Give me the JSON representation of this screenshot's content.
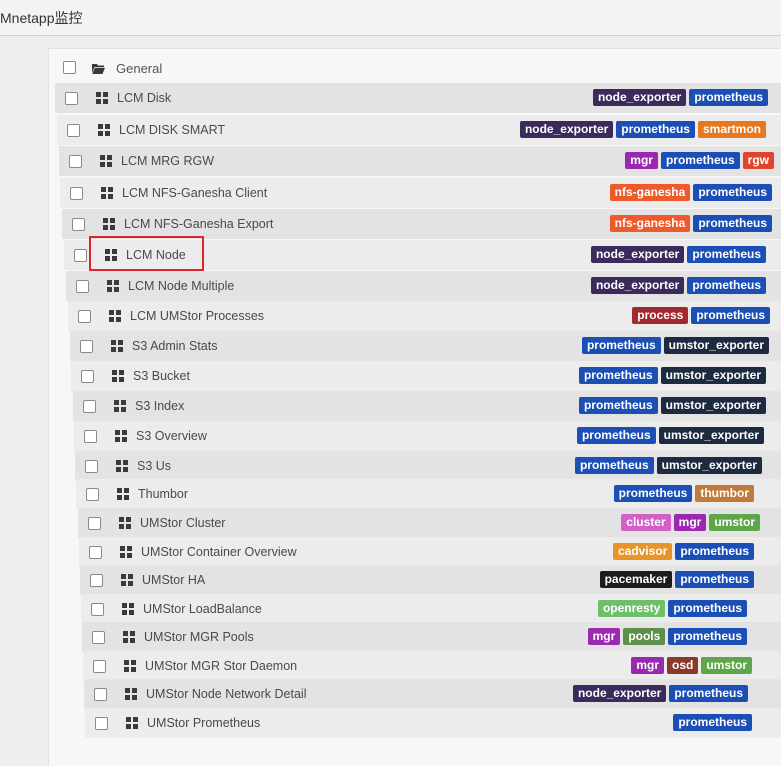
{
  "app": {
    "title": "Mnetapp监控"
  },
  "folder": {
    "label": "General"
  },
  "dashboards": [
    {
      "name": "LCM Disk",
      "tags": [
        {
          "label": "node_exporter",
          "color": "#3b2a5c"
        },
        {
          "label": "prometheus",
          "color": "#1b4fb5"
        }
      ]
    },
    {
      "name": "LCM DISK SMART",
      "tags": [
        {
          "label": "node_exporter",
          "color": "#3b2a5c"
        },
        {
          "label": "prometheus",
          "color": "#1b4fb5"
        },
        {
          "label": "smartmon",
          "color": "#e6781f"
        }
      ]
    },
    {
      "name": "LCM MRG RGW",
      "tags": [
        {
          "label": "mgr",
          "color": "#9b28b0"
        },
        {
          "label": "prometheus",
          "color": "#1b4fb5"
        },
        {
          "label": "rgw",
          "color": "#e0452c"
        }
      ]
    },
    {
      "name": "LCM NFS-Ganesha Client",
      "tags": [
        {
          "label": "nfs-ganesha",
          "color": "#ee5a2c"
        },
        {
          "label": "prometheus",
          "color": "#1b4fb5"
        }
      ]
    },
    {
      "name": "LCM NFS-Ganesha Export",
      "tags": [
        {
          "label": "nfs-ganesha",
          "color": "#ee5a2c"
        },
        {
          "label": "prometheus",
          "color": "#1b4fb5"
        }
      ]
    },
    {
      "name": "LCM Node",
      "tags": [
        {
          "label": "node_exporter",
          "color": "#3b2a5c"
        },
        {
          "label": "prometheus",
          "color": "#1b4fb5"
        }
      ]
    },
    {
      "name": "LCM Node Multiple",
      "tags": [
        {
          "label": "node_exporter",
          "color": "#3b2a5c"
        },
        {
          "label": "prometheus",
          "color": "#1b4fb5"
        }
      ]
    },
    {
      "name": "LCM UMStor Processes",
      "tags": [
        {
          "label": "process",
          "color": "#a12a2e"
        },
        {
          "label": "prometheus",
          "color": "#1b4fb5"
        }
      ]
    },
    {
      "name": "S3 Admin Stats",
      "tags": [
        {
          "label": "prometheus",
          "color": "#1b4fb5"
        },
        {
          "label": "umstor_exporter",
          "color": "#1e2a40"
        }
      ]
    },
    {
      "name": "S3 Bucket",
      "tags": [
        {
          "label": "prometheus",
          "color": "#1b4fb5"
        },
        {
          "label": "umstor_exporter",
          "color": "#1e2a40"
        }
      ]
    },
    {
      "name": "S3 Index",
      "tags": [
        {
          "label": "prometheus",
          "color": "#1b4fb5"
        },
        {
          "label": "umstor_exporter",
          "color": "#1e2a40"
        }
      ]
    },
    {
      "name": "S3 Overview",
      "tags": [
        {
          "label": "prometheus",
          "color": "#1b4fb5"
        },
        {
          "label": "umstor_exporter",
          "color": "#1e2a40"
        }
      ]
    },
    {
      "name": "S3 Us",
      "tags": [
        {
          "label": "prometheus",
          "color": "#1b4fb5"
        },
        {
          "label": "umstor_exporter",
          "color": "#1e2a40"
        }
      ]
    },
    {
      "name": "Thumbor",
      "tags": [
        {
          "label": "prometheus",
          "color": "#1b4fb5"
        },
        {
          "label": "thumbor",
          "color": "#c07a3a"
        }
      ]
    },
    {
      "name": "UMStor Cluster",
      "tags": [
        {
          "label": "cluster",
          "color": "#d45fc8"
        },
        {
          "label": "mgr",
          "color": "#9b28b0"
        },
        {
          "label": "umstor",
          "color": "#5fa64a"
        }
      ]
    },
    {
      "name": "UMStor Container Overview",
      "tags": [
        {
          "label": "cadvisor",
          "color": "#e6952a"
        },
        {
          "label": "prometheus",
          "color": "#1b4fb5"
        }
      ]
    },
    {
      "name": "UMStor HA",
      "tags": [
        {
          "label": "pacemaker",
          "color": "#1c1c1c"
        },
        {
          "label": "prometheus",
          "color": "#1b4fb5"
        }
      ]
    },
    {
      "name": "UMStor LoadBalance",
      "tags": [
        {
          "label": "openresty",
          "color": "#6fbf6a"
        },
        {
          "label": "prometheus",
          "color": "#1b4fb5"
        }
      ]
    },
    {
      "name": "UMStor MGR Pools",
      "tags": [
        {
          "label": "mgr",
          "color": "#9b28b0"
        },
        {
          "label": "pools",
          "color": "#5f8f4a"
        },
        {
          "label": "prometheus",
          "color": "#1b4fb5"
        }
      ]
    },
    {
      "name": "UMStor MGR Stor Daemon",
      "tags": [
        {
          "label": "mgr",
          "color": "#9b28b0"
        },
        {
          "label": "osd",
          "color": "#8a3a2a"
        },
        {
          "label": "umstor",
          "color": "#5fa64a"
        }
      ]
    },
    {
      "name": "UMStor Node Network Detail",
      "tags": [
        {
          "label": "node_exporter",
          "color": "#3b2a5c"
        },
        {
          "label": "prometheus",
          "color": "#1b4fb5"
        }
      ]
    },
    {
      "name": "UMStor Prometheus",
      "tags": [
        {
          "label": "prometheus",
          "color": "#1b4fb5"
        }
      ]
    }
  ],
  "highlighted_item": "LCM Node"
}
